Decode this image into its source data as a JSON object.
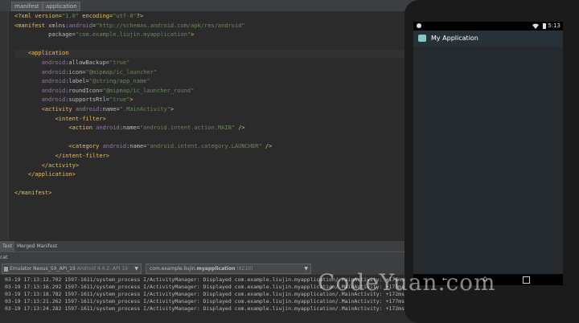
{
  "breadcrumb": [
    "manifest",
    "application"
  ],
  "code": {
    "lines": [
      [
        {
          "t": "<?xml version=",
          "c": "tag"
        },
        {
          "t": "\"1.0\"",
          "c": "val"
        },
        {
          "t": " encoding=",
          "c": "tag"
        },
        {
          "t": "\"utf-8\"",
          "c": "val"
        },
        {
          "t": "?>",
          "c": "tag"
        }
      ],
      [
        {
          "t": "<manifest ",
          "c": "tag"
        },
        {
          "t": "xmlns:",
          "c": "attr"
        },
        {
          "t": "android",
          "c": "ns"
        },
        {
          "t": "=",
          "c": "attr"
        },
        {
          "t": "\"http://schemas.android.com/apk/res/android\"",
          "c": "val"
        }
      ],
      [
        {
          "t": "          package=",
          "c": "attr"
        },
        {
          "t": "\"com.example.liujin.myapplication\"",
          "c": "val"
        },
        {
          "t": ">",
          "c": "tag"
        }
      ],
      [],
      [
        {
          "t": "    <application",
          "c": "tag"
        }
      ],
      [
        {
          "t": "        android",
          "c": "ns"
        },
        {
          "t": ":allowBackup=",
          "c": "attr"
        },
        {
          "t": "\"true\"",
          "c": "val"
        }
      ],
      [
        {
          "t": "        android",
          "c": "ns"
        },
        {
          "t": ":icon=",
          "c": "attr"
        },
        {
          "t": "\"@mipmap/ic_launcher\"",
          "c": "val"
        }
      ],
      [
        {
          "t": "        android",
          "c": "ns"
        },
        {
          "t": ":label=",
          "c": "attr"
        },
        {
          "t": "\"@string/app_name\"",
          "c": "val"
        }
      ],
      [
        {
          "t": "        android",
          "c": "ns"
        },
        {
          "t": ":roundIcon=",
          "c": "attr"
        },
        {
          "t": "\"@mipmap/ic_launcher_round\"",
          "c": "val"
        }
      ],
      [
        {
          "t": "        android",
          "c": "ns"
        },
        {
          "t": ":supportsRtl=",
          "c": "attr"
        },
        {
          "t": "\"true\"",
          "c": "val"
        },
        {
          "t": ">",
          "c": "tag"
        }
      ],
      [
        {
          "t": "        <activity ",
          "c": "tag"
        },
        {
          "t": "android",
          "c": "ns"
        },
        {
          "t": ":name=",
          "c": "attr"
        },
        {
          "t": "\".MainActivity\"",
          "c": "val"
        },
        {
          "t": ">",
          "c": "tag"
        }
      ],
      [
        {
          "t": "            <intent-filter>",
          "c": "tag"
        }
      ],
      [
        {
          "t": "                <action ",
          "c": "tag"
        },
        {
          "t": "android",
          "c": "ns"
        },
        {
          "t": ":name=",
          "c": "attr"
        },
        {
          "t": "\"android.intent.action.MAIN\"",
          "c": "val"
        },
        {
          "t": " />",
          "c": "tag"
        }
      ],
      [],
      [
        {
          "t": "                <category ",
          "c": "tag"
        },
        {
          "t": "android",
          "c": "ns"
        },
        {
          "t": ":name=",
          "c": "attr"
        },
        {
          "t": "\"android.intent.category.LAUNCHER\"",
          "c": "val"
        },
        {
          "t": " />",
          "c": "tag"
        }
      ],
      [
        {
          "t": "            </intent-filter>",
          "c": "tag"
        }
      ],
      [
        {
          "t": "        </activity>",
          "c": "tag"
        }
      ],
      [
        {
          "t": "    </application>",
          "c": "tag"
        }
      ],
      [],
      [
        {
          "t": "</manifest>",
          "c": "tag"
        }
      ]
    ],
    "highlighted_line": 4
  },
  "editor_tabs": [
    "Text",
    "Merged Manifest"
  ],
  "logcat": {
    "header_label": "cat",
    "device": "Emulator Nexus_5X_API_19",
    "device_detail": "Android 4.4.2, API 19",
    "process": "com.example.liujin.",
    "process_bold": "myapplication",
    "pid": "(8210)",
    "lines": [
      "03-19 17:13:12.702 1597-1611/system_process I/ActivityManager: Displayed com.example.liujin.myapplication/.MainActivity: +176ms",
      "03-19 17:13:16.292 1597-1611/system_process I/ActivityManager: Displayed com.example.liujin.myapplication/.MainActivity: +173ms",
      "03-19 17:13:18.782 1597-1611/system_process I/ActivityManager: Displayed com.example.liujin.myapplication/.MainActivity: +172ms",
      "03-19 17:13:21.262 1597-1611/system_process I/ActivityManager: Displayed com.example.liujin.myapplication/.MainActivity: +177ms",
      "03-19 17:13:24.282 1597-1611/system_process I/ActivityManager: Displayed com.example.liujin.myapplication/.MainActivity: +172ms"
    ]
  },
  "emulator": {
    "time": "5:13",
    "app_title": "My Application",
    "app_bar_color": "#263238",
    "accent_color": "#80cbc4"
  },
  "watermark": "CodeYuan.com"
}
